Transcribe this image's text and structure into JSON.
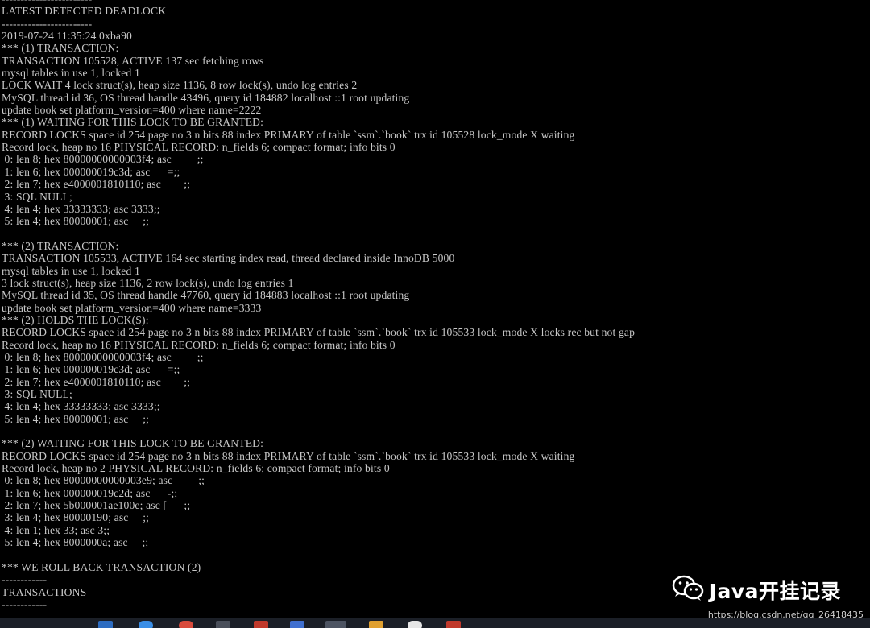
{
  "terminal": {
    "lines": [
      "------------------------",
      "LATEST DETECTED DEADLOCK",
      "------------------------",
      "2019-07-24 11:35:24 0xba90",
      "*** (1) TRANSACTION:",
      "TRANSACTION 105528, ACTIVE 137 sec fetching rows",
      "mysql tables in use 1, locked 1",
      "LOCK WAIT 4 lock struct(s), heap size 1136, 8 row lock(s), undo log entries 2",
      "MySQL thread id 36, OS thread handle 43496, query id 184882 localhost ::1 root updating",
      "update book set platform_version=400 where name=2222",
      "*** (1) WAITING FOR THIS LOCK TO BE GRANTED:",
      "RECORD LOCKS space id 254 page no 3 n bits 88 index PRIMARY of table `ssm`.`book` trx id 105528 lock_mode X waiting",
      "Record lock, heap no 16 PHYSICAL RECORD: n_fields 6; compact format; info bits 0",
      " 0: len 8; hex 80000000000003f4; asc         ;;",
      " 1: len 6; hex 000000019c3d; asc      =;;",
      " 2: len 7; hex e4000001810110; asc        ;;",
      " 3: SQL NULL;",
      " 4: len 4; hex 33333333; asc 3333;;",
      " 5: len 4; hex 80000001; asc     ;;",
      "",
      "*** (2) TRANSACTION:",
      "TRANSACTION 105533, ACTIVE 164 sec starting index read, thread declared inside InnoDB 5000",
      "mysql tables in use 1, locked 1",
      "3 lock struct(s), heap size 1136, 2 row lock(s), undo log entries 1",
      "MySQL thread id 35, OS thread handle 47760, query id 184883 localhost ::1 root updating",
      "update book set platform_version=400 where name=3333",
      "*** (2) HOLDS THE LOCK(S):",
      "RECORD LOCKS space id 254 page no 3 n bits 88 index PRIMARY of table `ssm`.`book` trx id 105533 lock_mode X locks rec but not gap",
      "Record lock, heap no 16 PHYSICAL RECORD: n_fields 6; compact format; info bits 0",
      " 0: len 8; hex 80000000000003f4; asc         ;;",
      " 1: len 6; hex 000000019c3d; asc      =;;",
      " 2: len 7; hex e4000001810110; asc        ;;",
      " 3: SQL NULL;",
      " 4: len 4; hex 33333333; asc 3333;;",
      " 5: len 4; hex 80000001; asc     ;;",
      "",
      "*** (2) WAITING FOR THIS LOCK TO BE GRANTED:",
      "RECORD LOCKS space id 254 page no 3 n bits 88 index PRIMARY of table `ssm`.`book` trx id 105533 lock_mode X waiting",
      "Record lock, heap no 2 PHYSICAL RECORD: n_fields 6; compact format; info bits 0",
      " 0: len 8; hex 80000000000003e9; asc         ;;",
      " 1: len 6; hex 000000019c2d; asc      -;;",
      " 2: len 7; hex 5b000001ae100e; asc [      ;;",
      " 3: len 4; hex 80000190; asc     ;;",
      " 4: len 1; hex 33; asc 3;;",
      " 5: len 4; hex 8000000a; asc     ;;",
      "",
      "*** WE ROLL BACK TRANSACTION (2)",
      "------------",
      "TRANSACTIONS",
      "------------"
    ]
  },
  "watermark": {
    "icon": "wechat-icon",
    "text": "Java开挂记录",
    "url": "https://blog.csdn.net/qq_26418435"
  },
  "taskbar": {
    "background": "#1b1f27"
  }
}
